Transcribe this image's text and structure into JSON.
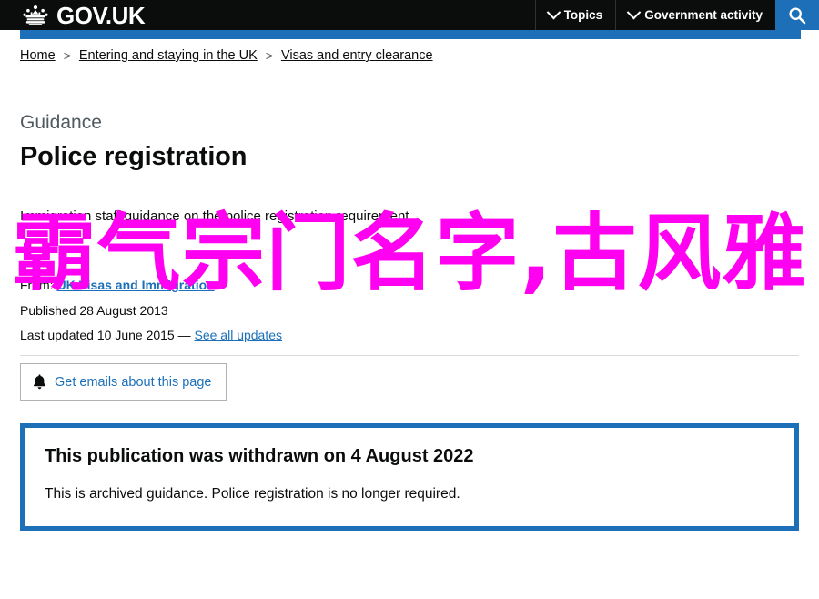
{
  "header": {
    "logo_text": "GOV.UK",
    "crown_icon": "crown-icon",
    "nav": [
      {
        "label": "Topics",
        "icon": "chevron-down-icon"
      },
      {
        "label": "Government activity",
        "icon": "chevron-down-icon"
      }
    ],
    "search_icon": "search-icon"
  },
  "breadcrumbs": [
    {
      "label": "Home"
    },
    {
      "label": "Entering and staying in the UK"
    },
    {
      "label": "Visas and entry clearance"
    }
  ],
  "breadcrumb_separator": ">",
  "title_block": {
    "context_label": "Guidance",
    "title": "Police registration",
    "lede": "Immigration staff guidance on the police registration requirement."
  },
  "metadata": {
    "from_label": "From:",
    "from_link": "UK Visas and Immigration",
    "published_label": "Published",
    "published_date": "28 August 2013",
    "last_updated_label": "Last updated",
    "last_updated_date": "10 June 2015",
    "dash": "—",
    "see_all_updates": "See all updates"
  },
  "email_button": {
    "label": "Get emails about this page",
    "icon": "bell-icon"
  },
  "withdrawal_notice": {
    "title": "This publication was withdrawn on 4 August 2022",
    "text": "This is archived guidance. Police registration is no longer required."
  },
  "watermark": {
    "text": "霸气宗门名字,古风雅"
  },
  "colors": {
    "brand_blue": "#1d70b8",
    "header_black": "#0b0c0c",
    "grey_text": "#505a5f",
    "watermark_pink": "#ff00f0",
    "rule_grey": "#d8dadb"
  }
}
